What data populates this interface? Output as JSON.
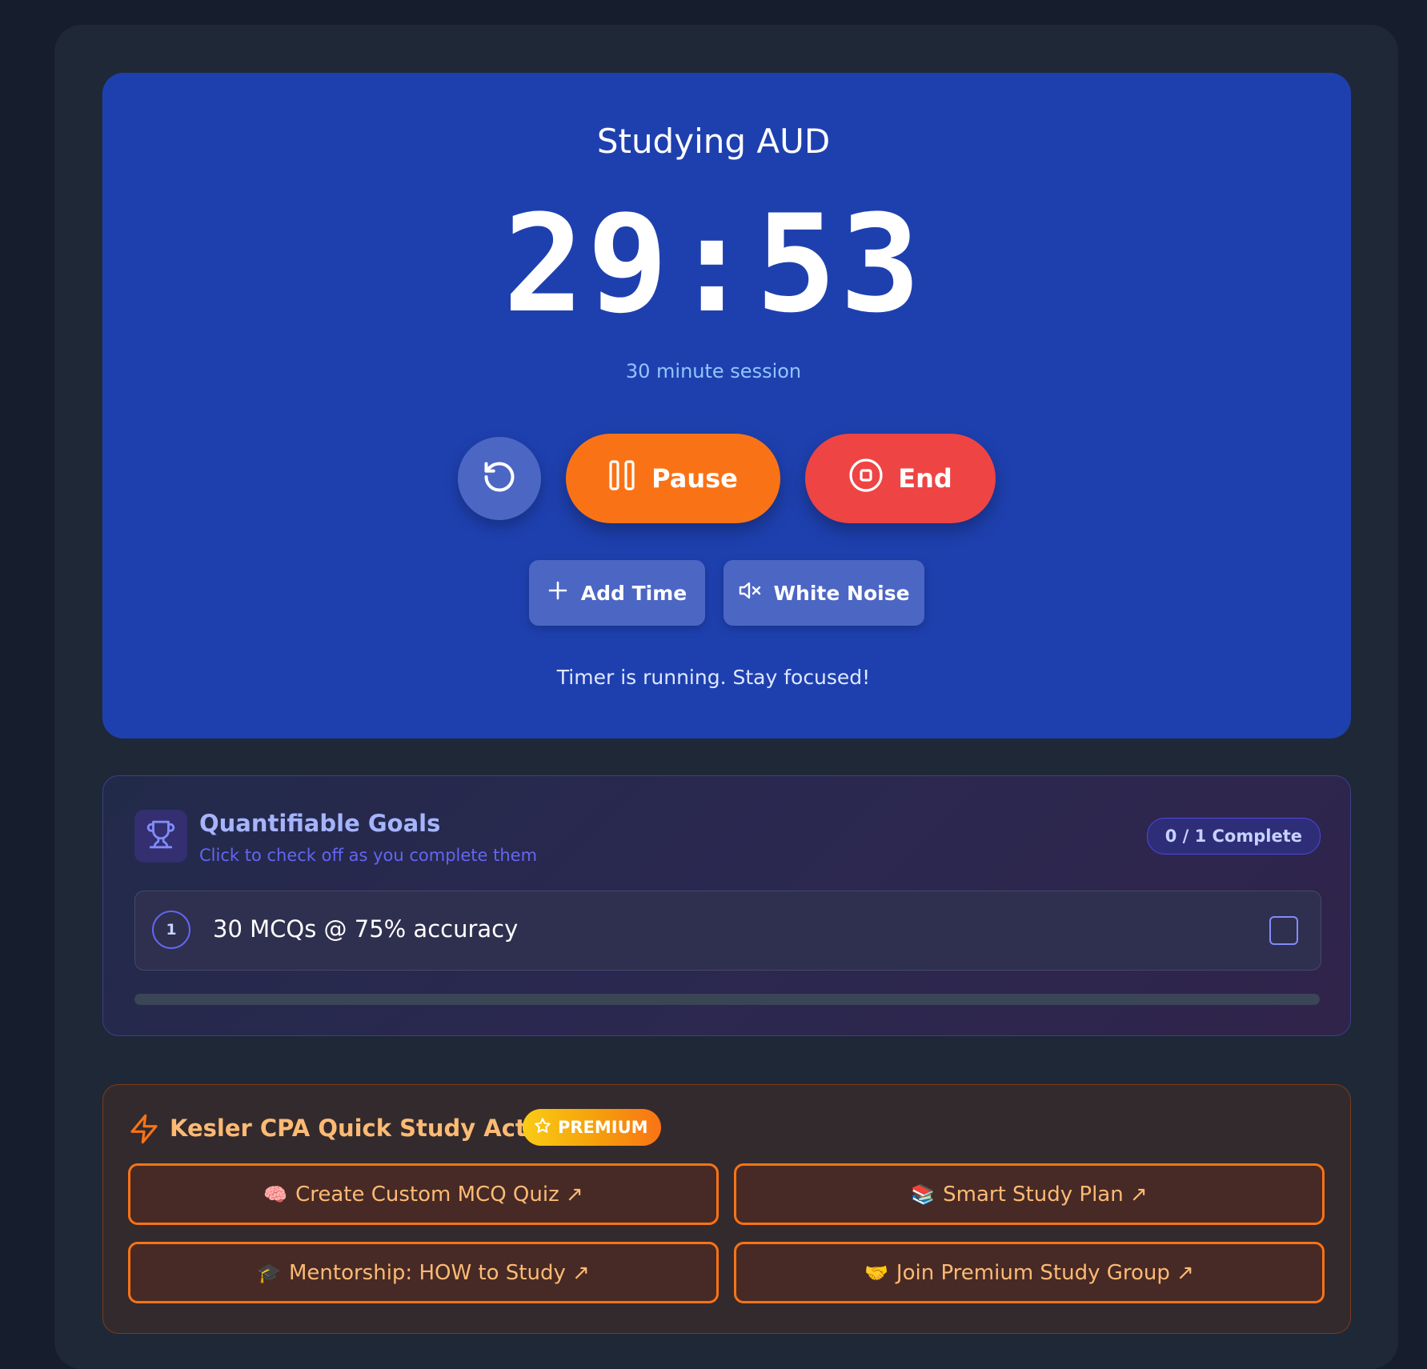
{
  "timer": {
    "title": "Studying AUD",
    "time": "29:53",
    "session_label": "30 minute session",
    "pause_label": "Pause",
    "end_label": "End",
    "add_time_label": "Add Time",
    "white_noise_label": "White Noise",
    "status_text": "Timer is running. Stay focused!"
  },
  "goals": {
    "title": "Quantifiable Goals",
    "subtitle": "Click to check off as you complete them",
    "count_label": "0 / 1 Complete",
    "progress_percent": 0,
    "items": [
      {
        "number": "1",
        "text": "30 MCQs @ 75% accuracy",
        "checked": false
      }
    ]
  },
  "actions": {
    "title": "Kesler CPA Quick Study Actions",
    "badge": "PREMIUM",
    "buttons": [
      {
        "emoji": "🧠",
        "label": "Create Custom MCQ Quiz ↗"
      },
      {
        "emoji": "📚",
        "label": "Smart Study Plan ↗"
      },
      {
        "emoji": "🎓",
        "label": "Mentorship: HOW to Study ↗"
      },
      {
        "emoji": "🤝",
        "label": "Join Premium Study Group ↗"
      }
    ]
  },
  "colors": {
    "timer_card_bg": "#1e40af",
    "pause_button": "#f97316",
    "end_button": "#ef4444",
    "accent_indigo": "#6366f1",
    "accent_orange": "#f97316",
    "premium_badge": "#f59e0b"
  },
  "icons": {
    "reset": "rotate-ccw-icon",
    "pause": "pause-icon",
    "end": "stop-circle-icon",
    "add_time": "plus-icon",
    "white_noise": "volume-x-icon",
    "goals": "trophy-icon",
    "actions": "zap-icon",
    "premium": "star-icon"
  }
}
